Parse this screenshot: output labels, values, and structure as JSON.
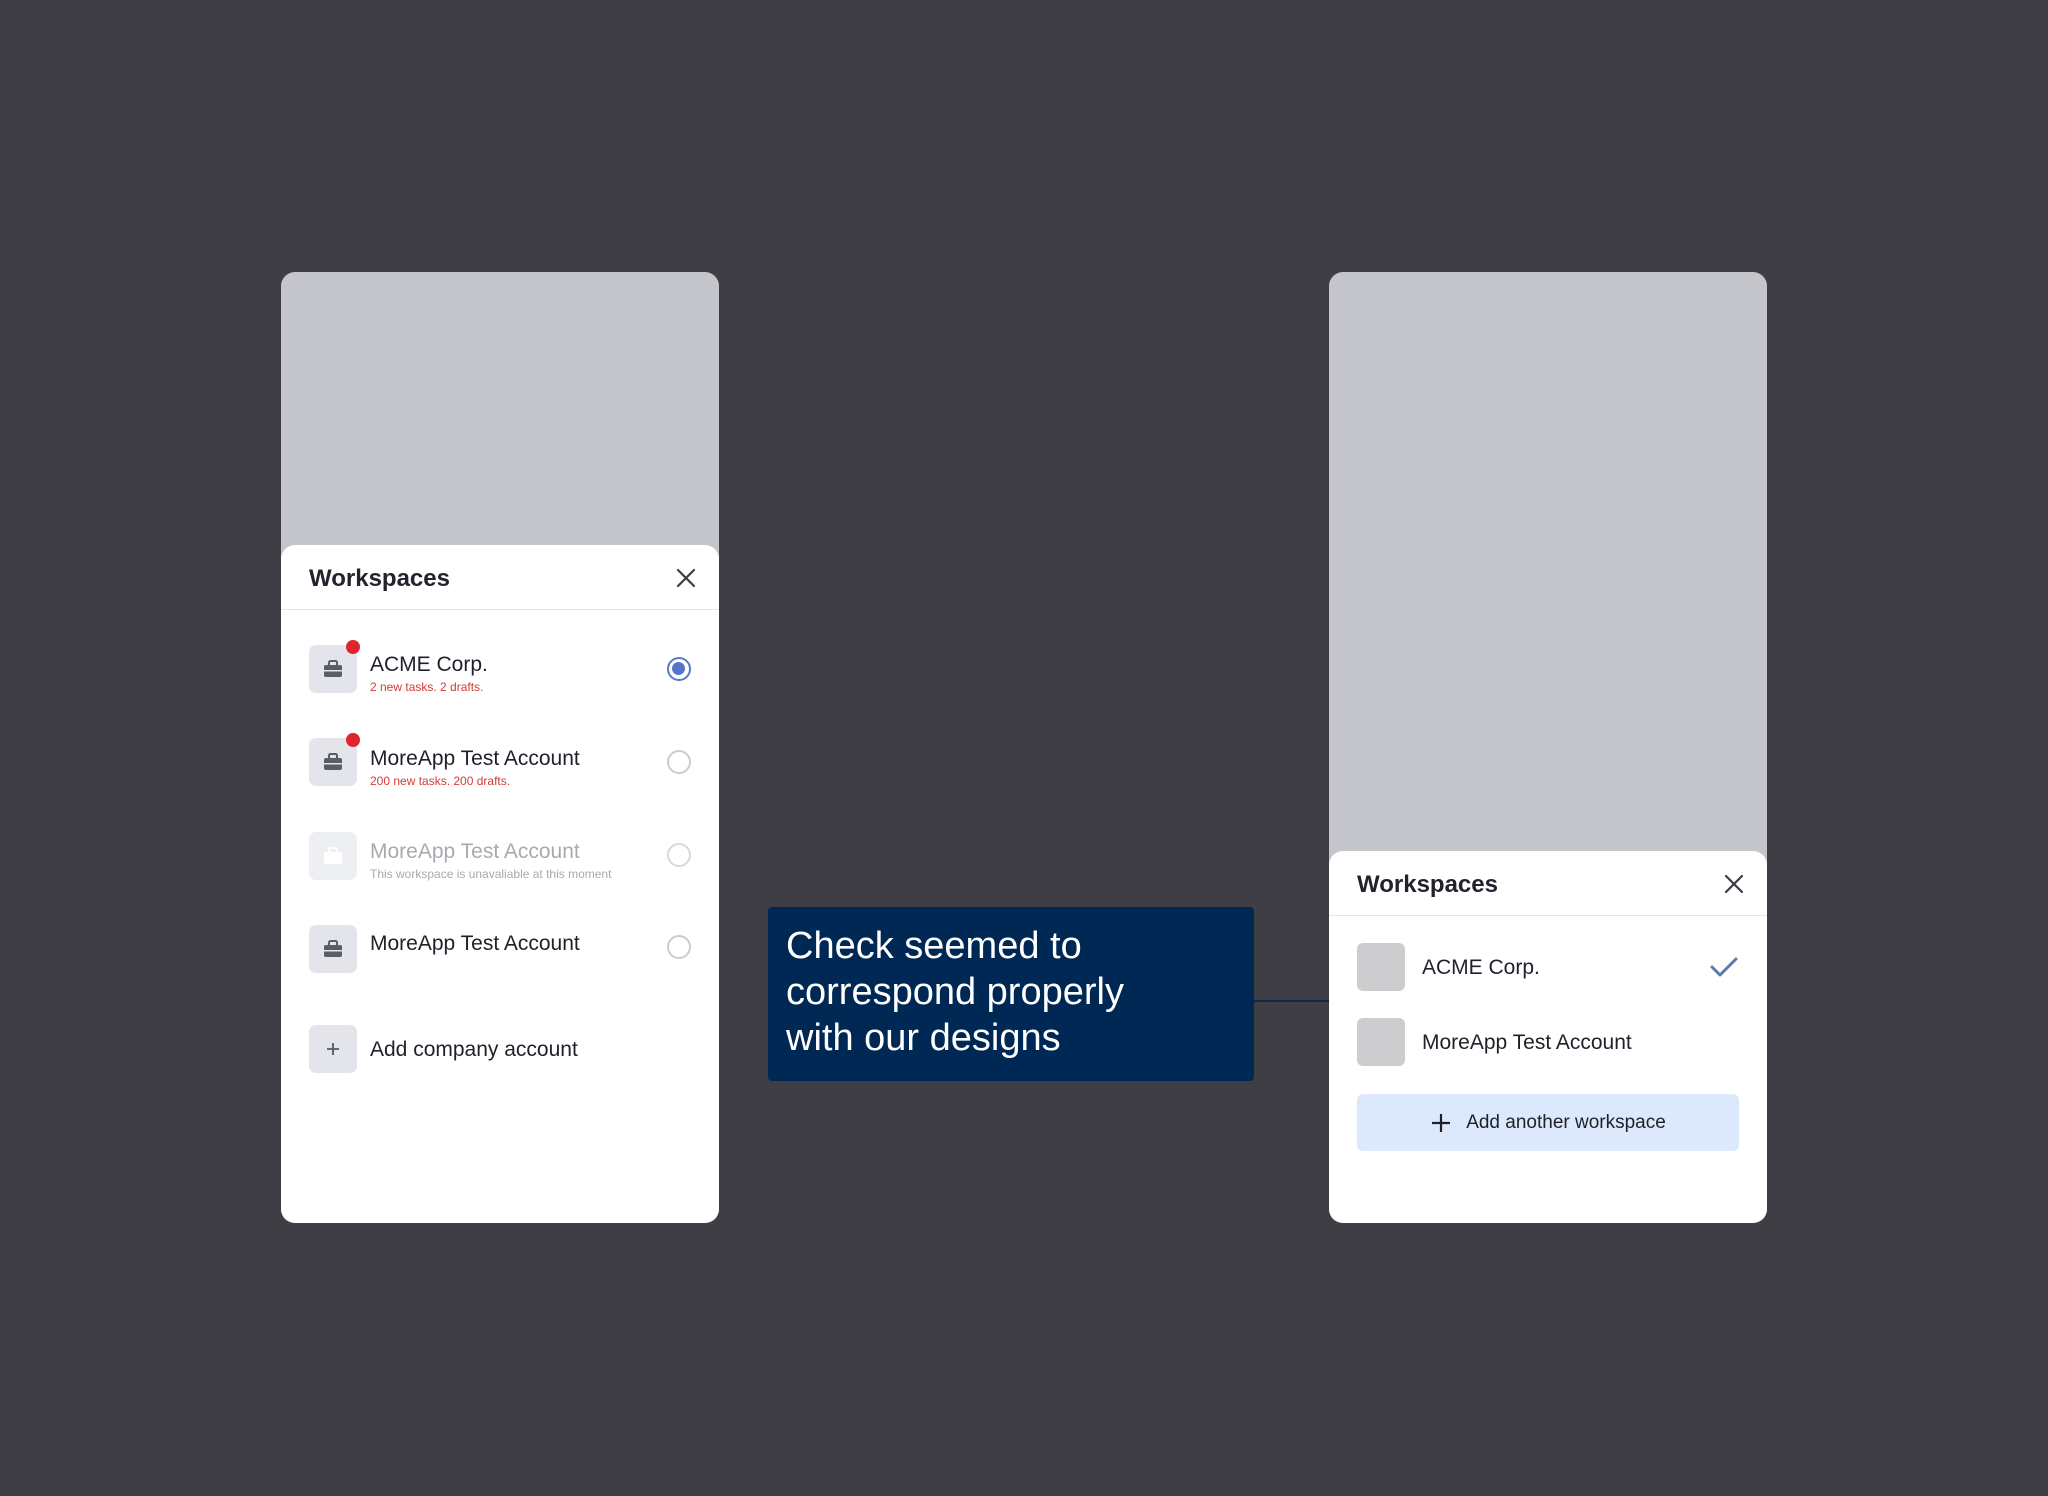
{
  "left_sheet": {
    "title": "Workspaces",
    "workspaces": [
      {
        "name": "ACME Corp.",
        "subtitle": "2 new tasks. 2 drafts.",
        "notification": true,
        "selected": true,
        "disabled": false
      },
      {
        "name": "MoreApp Test Account",
        "subtitle": "200 new tasks. 200 drafts.",
        "notification": true,
        "selected": false,
        "disabled": false
      },
      {
        "name": "MoreApp Test Account",
        "subtitle": "This workspace is unavaliable at this moment",
        "notification": false,
        "selected": false,
        "disabled": true
      },
      {
        "name": "MoreApp Test Account",
        "subtitle": "",
        "notification": false,
        "selected": false,
        "disabled": false
      }
    ],
    "add_label": "Add company account",
    "add_icon": "plus-icon"
  },
  "right_sheet": {
    "title": "Workspaces",
    "workspaces": [
      {
        "name": "ACME Corp.",
        "selected": true
      },
      {
        "name": "MoreApp Test Account",
        "selected": false
      }
    ],
    "add_button_label": "Add another workspace"
  },
  "annotation": {
    "lines": [
      "Check seemed to",
      "correspond properly",
      "with our designs"
    ]
  },
  "colors": {
    "background": "#3f3e45",
    "phone_placeholder": "#c5c6cb",
    "notification_red": "#e0262d",
    "radio_selected": "#5574c9",
    "annotation_bg": "#002855",
    "add_button_bg": "#dce8fc",
    "check_color": "#5d7aa8"
  }
}
